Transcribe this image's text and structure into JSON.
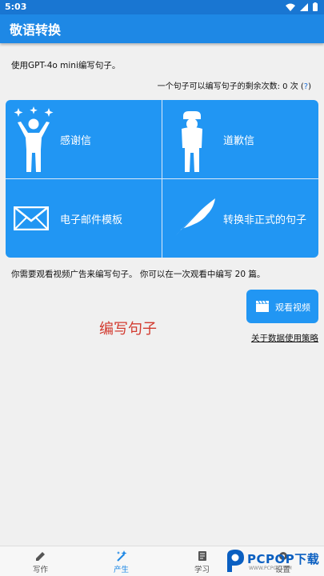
{
  "status_bar": {
    "time": "5:03"
  },
  "app_bar": {
    "title": "敬语转换"
  },
  "info_line": "使用GPT-4o mini编写句子。",
  "remaining": {
    "text": "一个句子可以编写句子的剩余次数: 0 次 (",
    "help": "?",
    "close": ")"
  },
  "tiles": [
    {
      "label": "感谢信",
      "icon": "cheering-person-icon"
    },
    {
      "label": "道歉信",
      "icon": "bowing-person-icon"
    },
    {
      "label": "电子邮件模板",
      "icon": "envelope-icon"
    },
    {
      "label": "转换非正式的句子",
      "icon": "feather-icon"
    }
  ],
  "ad_text": "你需要观看视频广告来编写句子。 你可以在一次观看中编写 20 篇。",
  "watch_button": {
    "label": "观看视频",
    "icon": "clapperboard-icon"
  },
  "write_heading": "编写句子",
  "policy_link": "关于数据使用策略",
  "bottom_nav": [
    {
      "label": "写作",
      "icon": "pencil-icon",
      "active": false
    },
    {
      "label": "产生",
      "icon": "sparkle-wand-icon",
      "active": true
    },
    {
      "label": "学习",
      "icon": "book-icon",
      "active": false
    },
    {
      "label": "设置",
      "icon": "gear-icon",
      "active": false
    }
  ],
  "watermark": {
    "text": "PCPOP下载",
    "subtext": "WWW.PCPOP.COM"
  },
  "colors": {
    "primary": "#2196f3",
    "appbar": "#1e88e5",
    "accent_red": "#d23a2f"
  }
}
